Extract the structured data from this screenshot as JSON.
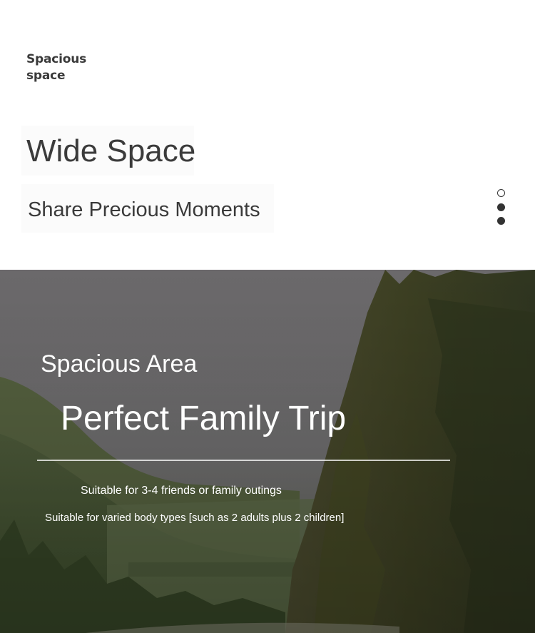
{
  "logo": {
    "line1": "Spacious",
    "line2": "space"
  },
  "hero": {
    "headline": "Wide Space",
    "subline": "Share Precious Moments"
  },
  "carousel": {
    "total": 3,
    "active_index": 0
  },
  "banner": {
    "area_title": "Spacious Area",
    "trip_title": "Perfect Family Trip",
    "line1": "Suitable for 3-4 friends or family outings",
    "line2": "Suitable for varied body types [such as 2 adults plus 2 children]"
  },
  "colors": {
    "text_dark": "#3a3a3a",
    "banner_text": "#ffffff",
    "sky": "#6e6c6e",
    "forest": "#3a3e22"
  }
}
